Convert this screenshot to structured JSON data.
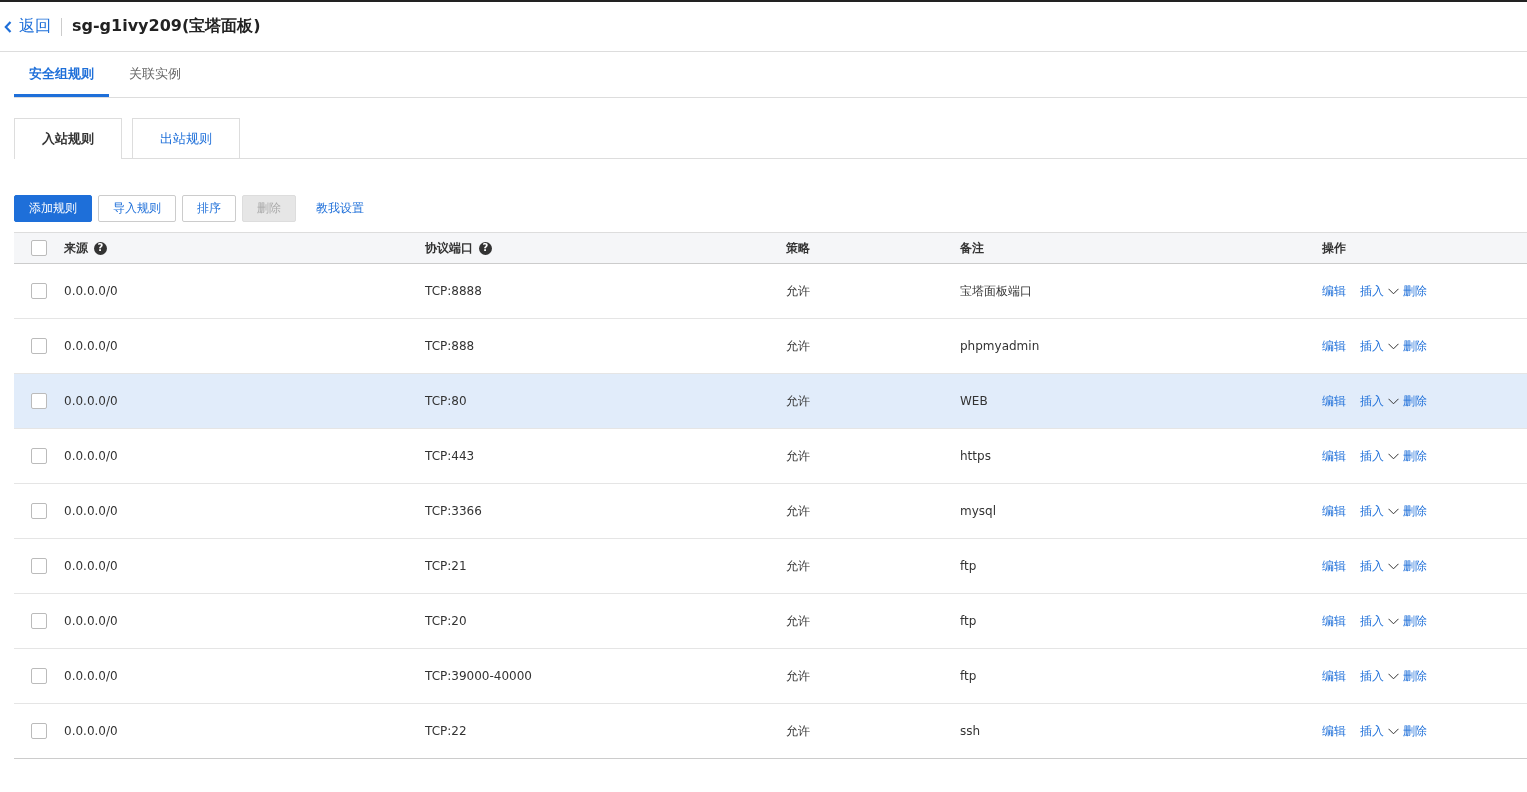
{
  "header": {
    "back": "返回",
    "title": "sg-g1ivy209(宝塔面板)"
  },
  "tabs": [
    {
      "label": "安全组规则",
      "selected": true
    },
    {
      "label": "关联实例",
      "selected": false
    }
  ],
  "subtabs": [
    {
      "label": "入站规则",
      "selected": true
    },
    {
      "label": "出站规则",
      "selected": false
    }
  ],
  "toolbar": [
    {
      "label": "添加规则",
      "kind": "primary"
    },
    {
      "label": "导入规则",
      "kind": "default"
    },
    {
      "label": "排序",
      "kind": "default"
    },
    {
      "label": "删除",
      "kind": "disabled"
    },
    {
      "label": "教我设置",
      "kind": "link"
    }
  ],
  "table": {
    "all_checked": false,
    "columns": [
      {
        "label": "来源",
        "help": "?"
      },
      {
        "label": "协议端口",
        "help": "?"
      },
      {
        "label": "策略"
      },
      {
        "label": "备注"
      },
      {
        "label": "操作"
      }
    ],
    "rows": [
      {
        "checked": false,
        "highlighted": false,
        "source": "0.0.0.0/0",
        "port": "TCP:8888",
        "policy": "允许",
        "remark": "宝塔面板端口",
        "edit": "编辑",
        "insert": "插入",
        "delete": "删除"
      },
      {
        "checked": false,
        "highlighted": false,
        "source": "0.0.0.0/0",
        "port": "TCP:888",
        "policy": "允许",
        "remark": "phpmyadmin",
        "edit": "编辑",
        "insert": "插入",
        "delete": "删除"
      },
      {
        "checked": false,
        "highlighted": true,
        "source": "0.0.0.0/0",
        "port": "TCP:80",
        "policy": "允许",
        "remark": "WEB",
        "edit": "编辑",
        "insert": "插入",
        "delete": "删除"
      },
      {
        "checked": false,
        "highlighted": false,
        "source": "0.0.0.0/0",
        "port": "TCP:443",
        "policy": "允许",
        "remark": "https",
        "edit": "编辑",
        "insert": "插入",
        "delete": "删除"
      },
      {
        "checked": false,
        "highlighted": false,
        "source": "0.0.0.0/0",
        "port": "TCP:3366",
        "policy": "允许",
        "remark": "mysql",
        "edit": "编辑",
        "insert": "插入",
        "delete": "删除"
      },
      {
        "checked": false,
        "highlighted": false,
        "source": "0.0.0.0/0",
        "port": "TCP:21",
        "policy": "允许",
        "remark": "ftp",
        "edit": "编辑",
        "insert": "插入",
        "delete": "删除"
      },
      {
        "checked": false,
        "highlighted": false,
        "source": "0.0.0.0/0",
        "port": "TCP:20",
        "policy": "允许",
        "remark": "ftp",
        "edit": "编辑",
        "insert": "插入",
        "delete": "删除"
      },
      {
        "checked": false,
        "highlighted": false,
        "source": "0.0.0.0/0",
        "port": "TCP:39000-40000",
        "policy": "允许",
        "remark": "ftp",
        "edit": "编辑",
        "insert": "插入",
        "delete": "删除"
      },
      {
        "checked": false,
        "highlighted": false,
        "source": "0.0.0.0/0",
        "port": "TCP:22",
        "policy": "允许",
        "remark": "ssh",
        "edit": "编辑",
        "insert": "插入",
        "delete": "删除"
      }
    ]
  }
}
